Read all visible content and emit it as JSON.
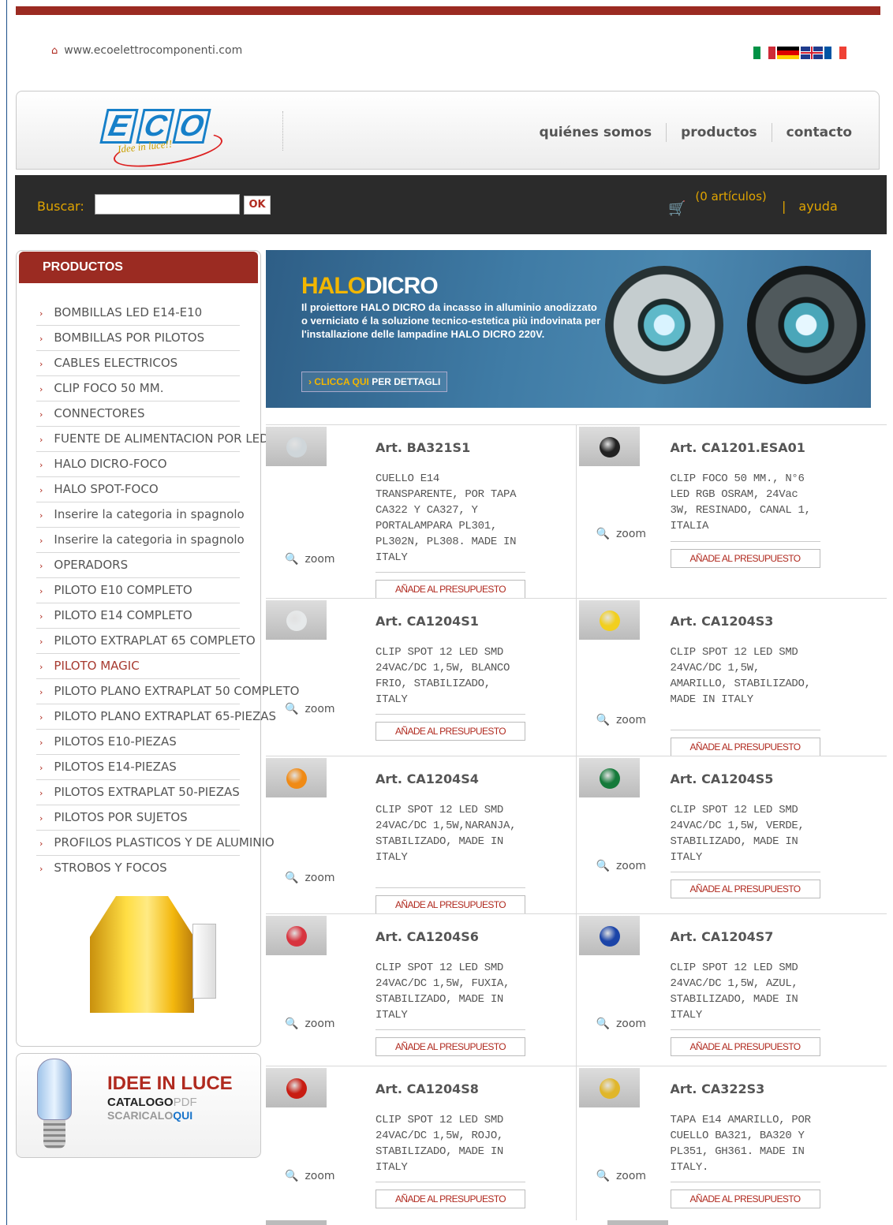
{
  "site": {
    "url": "www.ecoelettrocomponenti.com"
  },
  "flags": [
    "italian-flag-icon",
    "german-flag-icon",
    "uk-flag-icon",
    "french-flag-icon"
  ],
  "logo": {
    "letters": [
      "E",
      "C",
      "O"
    ],
    "tagline": "Idee in luce!!"
  },
  "nav": {
    "about": "quiénes somos",
    "products": "productos",
    "contact": "contacto"
  },
  "search": {
    "label": "Buscar:",
    "value": "",
    "button": "OK"
  },
  "cart": {
    "count_text": "(0 artículos)",
    "help_sep": "|",
    "help": "ayuda"
  },
  "sidebar": {
    "title": "PRODUCTOS",
    "categories": [
      {
        "label": "BOMBILLAS LED E14-E10"
      },
      {
        "label": "BOMBILLAS POR PILOTOS"
      },
      {
        "label": "CABLES ELECTRICOS"
      },
      {
        "label": "CLIP FOCO 50 MM."
      },
      {
        "label": "CONNECTORES"
      },
      {
        "label": "FUENTE DE ALIMENTACION POR LED"
      },
      {
        "label": "HALO DICRO-FOCO"
      },
      {
        "label": "HALO SPOT-FOCO"
      },
      {
        "label": "Inserire la categoria in spagnolo"
      },
      {
        "label": "Inserire la categoria in spagnolo"
      },
      {
        "label": "OPERADORS"
      },
      {
        "label": "PILOTO E10 COMPLETO"
      },
      {
        "label": "PILOTO E14 COMPLETO"
      },
      {
        "label": "PILOTO EXTRAPLAT 65 COMPLETO"
      },
      {
        "label": "PILOTO MAGIC"
      },
      {
        "label": "PILOTO PLANO EXTRAPLAT 50 COMPLETO"
      },
      {
        "label": "PILOTO PLANO EXTRAPLAT 65-PIEZAS"
      },
      {
        "label": "PILOTOS E10-PIEZAS"
      },
      {
        "label": "PILOTOS E14-PIEZAS"
      },
      {
        "label": "PILOTOS EXTRAPLAT 50-PIEZAS"
      },
      {
        "label": "PILOTOS POR SUJETOS"
      },
      {
        "label": "PROFILOS PLASTICOS Y DE ALUMINIO"
      },
      {
        "label": "STROBOS Y FOCOS"
      }
    ]
  },
  "promo": {
    "title": "IDEE IN LUCE",
    "line1_a": "CATALOGO",
    "line1_b": "PDF",
    "line2_a": "SCARICALO",
    "line2_b": "QUI"
  },
  "banner": {
    "title_a": "HALO",
    "title_b": "DICRO",
    "text": "Il proiettore HALO DICRO da incasso in alluminio anodizzato o verniciato é la soluzione tecnico-estetica più indovinata per l'installazione delle lampadine HALO DICRO 220V.",
    "btn_a": "› CLICCA QUI",
    "btn_b": " PER DETTAGLI"
  },
  "products": [
    {
      "code": "Art. BA321S1",
      "desc": "CUELLO E14 TRANSPARENTE, POR TAPA CA322 Y CA327, Y PORTALAMPARA PL301, PL302N, PL308. MADE IN ITALY",
      "zoom": "zoom",
      "button": "AÑADE AL PRESUPUESTO",
      "color": "#cfd6da"
    },
    {
      "code": "Art. CA1201.ESA01",
      "desc": "CLIP FOCO 50 MM., N°6 LED RGB OSRAM, 24Vac 3W, RESINADO, CANAL 1, ITALIA",
      "zoom": "zoom",
      "button": "AÑADE AL PRESUPUESTO",
      "color": "#222222"
    },
    {
      "code": "Art. CA1204S1",
      "desc": "CLIP SPOT 12 LED SMD 24VAC/DC 1,5W, BLANCO FRIO, STABILIZADO, ITALY",
      "zoom": "zoom",
      "button": "AÑADE AL PRESUPUESTO",
      "color": "#e6e9ea"
    },
    {
      "code": "Art. CA1204S3",
      "desc": "CLIP SPOT 12 LED SMD 24VAC/DC 1,5W, AMARILLO, STABILIZADO, MADE IN ITALY",
      "zoom": "zoom",
      "button": "AÑADE AL PRESUPUESTO",
      "color": "#f2cf1e"
    },
    {
      "code": "Art. CA1204S4",
      "desc": "CLIP SPOT 12 LED SMD 24VAC/DC 1,5W,NARANJA, STABILIZADO, MADE IN ITALY",
      "zoom": "zoom",
      "button": "AÑADE AL PRESUPUESTO",
      "color": "#f08a15"
    },
    {
      "code": "Art. CA1204S5",
      "desc": "CLIP SPOT 12 LED SMD 24VAC/DC 1,5W, VERDE, STABILIZADO, MADE IN ITALY",
      "zoom": "zoom",
      "button": "AÑADE AL PRESUPUESTO",
      "color": "#157a3a"
    },
    {
      "code": "Art. CA1204S6",
      "desc": "CLIP SPOT 12 LED SMD 24VAC/DC 1,5W, FUXIA, STABILIZADO, MADE IN ITALY",
      "zoom": "zoom",
      "button": "AÑADE AL PRESUPUESTO",
      "color": "#d8343f"
    },
    {
      "code": "Art. CA1204S7",
      "desc": "CLIP SPOT 12 LED SMD 24VAC/DC 1,5W, AZUL, STABILIZADO, MADE IN ITALY",
      "zoom": "zoom",
      "button": "AÑADE AL PRESUPUESTO",
      "color": "#1b44a8"
    },
    {
      "code": "Art. CA1204S8",
      "desc": "CLIP SPOT 12 LED SMD 24VAC/DC 1,5W, ROJO, STABILIZADO, MADE IN ITALY",
      "zoom": "zoom",
      "button": "AÑADE AL PRESUPUESTO",
      "color": "#c81c12"
    },
    {
      "code": "Art. CA322S3",
      "desc": "TAPA E14 AMARILLO, POR CUELLO BA321, BA320 Y PL351, GH361. MADE IN ITALY.",
      "zoom": "zoom",
      "button": "AÑADE AL PRESUPUESTO",
      "color": "#e0b62a"
    }
  ]
}
